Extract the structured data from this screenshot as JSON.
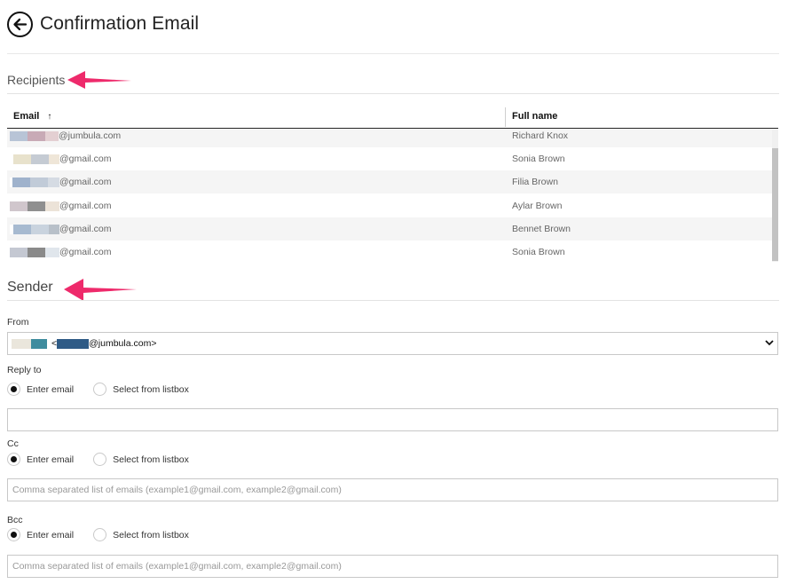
{
  "header": {
    "title": "Confirmation Email",
    "back_icon": "arrow-left-circle-icon"
  },
  "recipients": {
    "title": "Recipients",
    "columns": {
      "email": "Email",
      "email_sort": "↑",
      "full_name": "Full name"
    },
    "rows": [
      {
        "email_domain": "@jumbula.com",
        "full_name": "Richard Knox",
        "blur": [
          "#b8c4d6",
          "#c8aab6",
          "#e3cfd2"
        ]
      },
      {
        "email_domain": "@gmail.com",
        "full_name": "Sonia Brown",
        "blur": [
          "#e8e2cc",
          "#c5cbd3",
          "#efe6d8"
        ]
      },
      {
        "email_domain": "@gmail.com",
        "full_name": "Filia Brown",
        "blur": [
          "#9fb2cc",
          "#c1cbd8",
          "#d5dbe3"
        ]
      },
      {
        "email_domain": "@gmail.com",
        "full_name": "Aylar Brown",
        "blur": [
          "#d0c6cc",
          "#8f8f8f",
          "#ece3d8"
        ]
      },
      {
        "email_domain": "@gmail.com",
        "full_name": "Bennet Brown",
        "blur": [
          "#a7bad0",
          "#c9d3de",
          "#b8c0c9"
        ]
      },
      {
        "email_domain": "@gmail.com",
        "full_name": "Sonia Brown",
        "blur": [
          "#c4c8d2",
          "#8a8a8a",
          "#e0e6ec"
        ]
      }
    ]
  },
  "sender": {
    "title": "Sender",
    "from_label": "From",
    "from_value_suffix": "@jumbula.com>",
    "from_value_prefix": "<",
    "reply_to_label": "Reply to",
    "cc_label": "Cc",
    "bcc_label": "Bcc",
    "option_enter": "Enter email",
    "option_listbox": "Select from listbox",
    "reply_to_value": "",
    "cc_placeholder": "Comma separated list of emails (example1@gmail.com, example2@gmail.com)",
    "bcc_placeholder": "Comma separated list of emails (example1@gmail.com, example2@gmail.com)"
  },
  "colors": {
    "annotation_arrow": "#ee2a6b"
  }
}
